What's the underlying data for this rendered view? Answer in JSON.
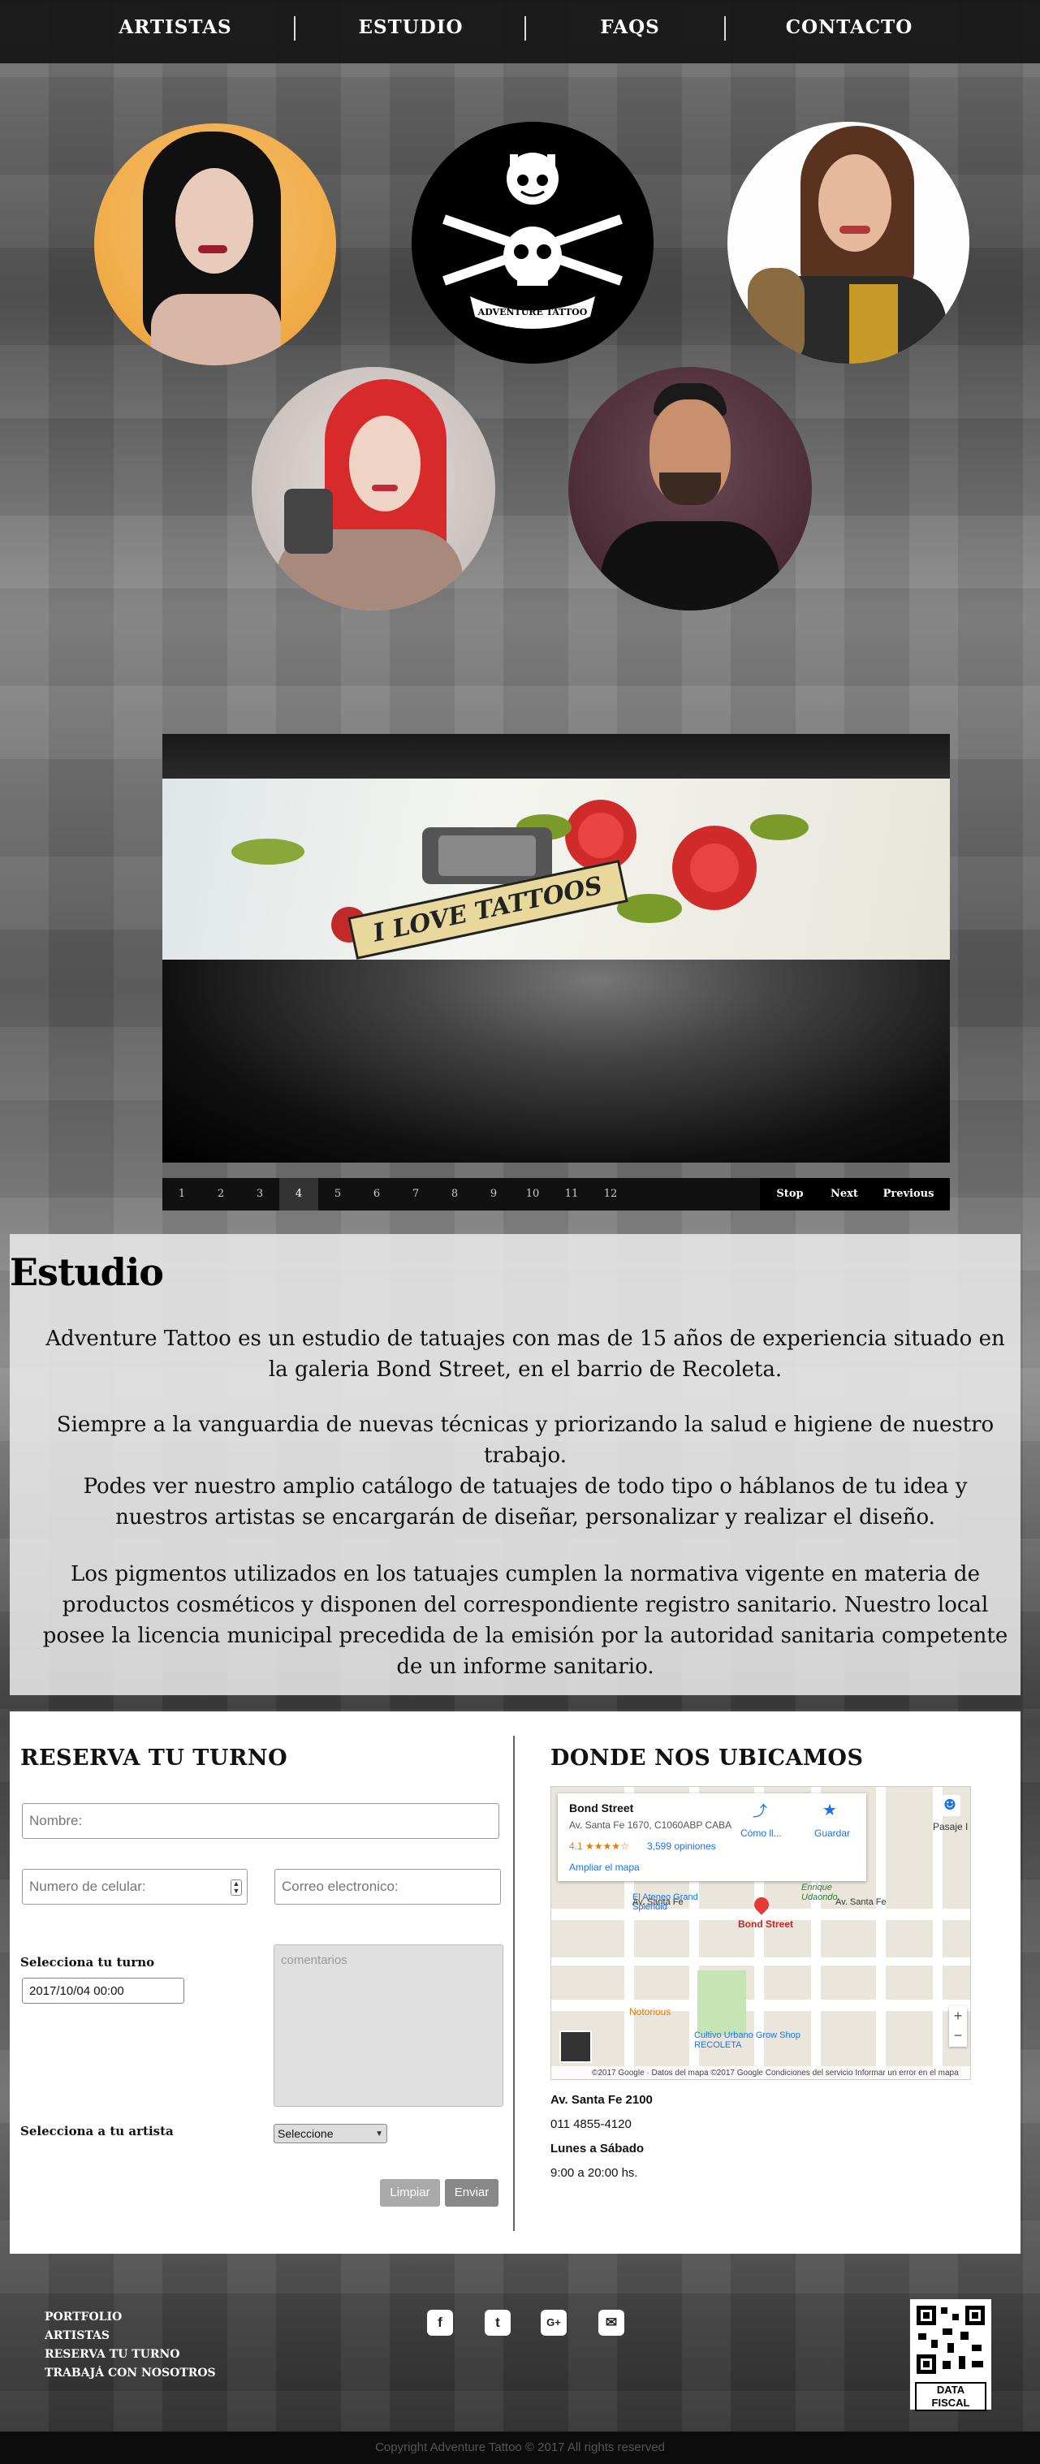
{
  "nav": {
    "items": [
      {
        "label": "ARTISTAS"
      },
      {
        "label": "ESTUDIO"
      },
      {
        "label": "FAQS"
      },
      {
        "label": "CONTACTO"
      }
    ]
  },
  "hero": {
    "logo_text": "ADVENTURE TATTOO"
  },
  "slider": {
    "caption": "I LOVE TATTOOS",
    "pages": [
      "1",
      "2",
      "3",
      "4",
      "5",
      "6",
      "7",
      "8",
      "9",
      "10",
      "11",
      "12"
    ],
    "active_page": "4",
    "stop_label": "Stop",
    "next_label": "Next",
    "previous_label": "Previous"
  },
  "estudio": {
    "title": "Estudio",
    "p1": "Adventure Tattoo es un estudio de tatuajes con mas de 15 años de experiencia situado en la galeria Bond Street, en el barrio de Recoleta.",
    "p2a": "Siempre a la vanguardia de nuevas técnicas y priorizando la salud e higiene de nuestro trabajo.",
    "p2b": "Podes ver nuestro amplio catálogo de tatuajes de todo tipo o háblanos de tu idea y nuestros artistas se encargarán de diseñar, personalizar y realizar el diseño.",
    "p3": "Los pigmentos utilizados en los tatuajes cumplen la normativa vigente en materia de productos cosméticos y disponen del correspondiente registro sanitario. Nuestro local posee la licencia municipal precedida de la emisión por la autoridad sanitaria competente de un informe sanitario."
  },
  "reserva": {
    "title": "RESERVA TU TURNO",
    "name_placeholder": "Nombre:",
    "phone_placeholder": "Numero de celular:",
    "email_placeholder": "Correo electronico:",
    "date_label": "Selecciona tu turno",
    "date_value": "2017/10/04 00:00",
    "comments_placeholder": "comentarios",
    "artist_label": "Selecciona a tu artista",
    "artist_value": "Seleccione",
    "clear_label": "Limpiar",
    "send_label": "Enviar"
  },
  "ubicacion": {
    "title": "DONDE NOS UBICAMOS",
    "map": {
      "place_name": "Bond Street",
      "place_address": "Av. Santa Fe 1670, C1060ABP CABA",
      "rating": "4.1",
      "stars": "★★★★☆",
      "reviews": "3,599 opiniones",
      "directions_label": "Cómo ll...",
      "save_label": "Guardar",
      "bigger_map": "Ampliar el mapa",
      "pasaje": "Pasaje I",
      "ateneo": "El Ateneo Grand Splendid",
      "enrique": "Enrique Udaondo",
      "notorious": "Notorious",
      "cultivo": "Cultivo Urbano Grow Shop RECOLETA",
      "pin_label": "Bond Street",
      "street_santafe": "Av. Santa Fe",
      "footer_text": "©2017 Google · Datos del mapa ©2017 Google  Condiciones del servicio  Informar un error en el mapa"
    },
    "address": "Av. Santa Fe 2100",
    "phone": "011 4855-4120",
    "days": "Lunes a Sábado",
    "hours": "9:00 a 20:00 hs."
  },
  "footer": {
    "links": [
      "PORTFOLIO",
      "ARTISTAS",
      "RESERVA TU TURNO",
      "TRABAJÁ CON NOSOTROS"
    ],
    "social_icons": [
      "facebook-icon",
      "twitter-icon",
      "google-plus-icon",
      "email-icon"
    ],
    "data_fiscal": "DATA FISCAL",
    "copyright": "Copyright Adventure Tattoo © 2017 All rights reserved"
  }
}
